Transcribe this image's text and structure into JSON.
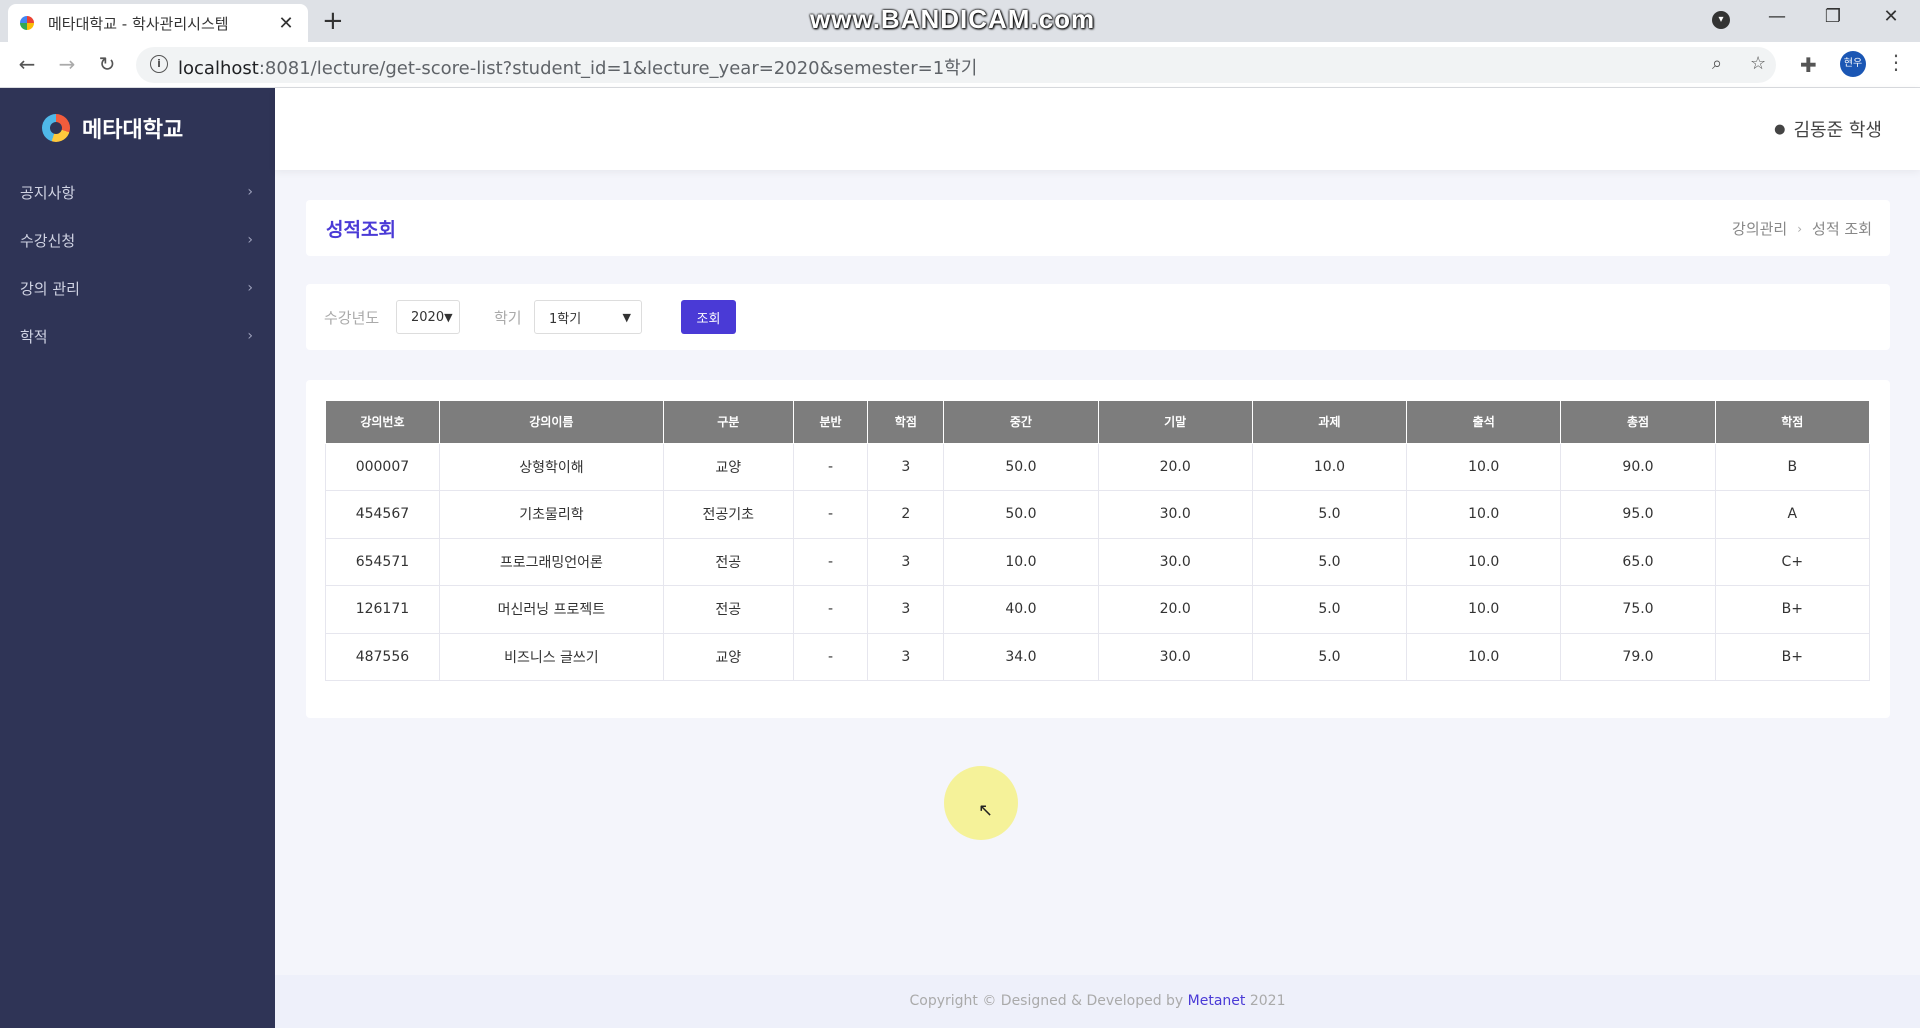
{
  "browser": {
    "tab_title": "메타대학교 - 학사관리시스템",
    "tab_close": "✕",
    "new_tab": "+",
    "watermark": "www.BANDICAM.com",
    "url_host": "localhost",
    "url_rest": ":8081/lecture/get-score-list?student_id=1&lecture_year=2020&semester=1학기",
    "profile_label": "현우"
  },
  "brand": {
    "name": "메타대학교"
  },
  "sidebar": {
    "items": [
      {
        "label": "공지사항"
      },
      {
        "label": "수강신청"
      },
      {
        "label": "강의 관리"
      },
      {
        "label": "학적"
      }
    ]
  },
  "header": {
    "user": "김동준 학생"
  },
  "page": {
    "title": "성적조회",
    "breadcrumb": [
      "강의관리",
      "성적 조회"
    ]
  },
  "filter": {
    "year_label": "수강년도",
    "year_value": "2020",
    "semester_label": "학기",
    "semester_value": "1학기",
    "search_label": "조회"
  },
  "table": {
    "headers": [
      "강의번호",
      "강의이름",
      "구분",
      "분반",
      "학점",
      "중간",
      "기말",
      "과제",
      "출석",
      "총점",
      "학점"
    ],
    "rows": [
      [
        "000007",
        "상형학이해",
        "교양",
        "-",
        "3",
        "50.0",
        "20.0",
        "10.0",
        "10.0",
        "90.0",
        "B"
      ],
      [
        "454567",
        "기초물리학",
        "전공기초",
        "-",
        "2",
        "50.0",
        "30.0",
        "5.0",
        "10.0",
        "95.0",
        "A"
      ],
      [
        "654571",
        "프로그래밍언어론",
        "전공",
        "-",
        "3",
        "10.0",
        "30.0",
        "5.0",
        "10.0",
        "65.0",
        "C+"
      ],
      [
        "126171",
        "머신러닝 프로젝트",
        "전공",
        "-",
        "3",
        "40.0",
        "20.0",
        "5.0",
        "10.0",
        "75.0",
        "B+"
      ],
      [
        "487556",
        "비즈니스 글쓰기",
        "교양",
        "-",
        "3",
        "34.0",
        "30.0",
        "5.0",
        "10.0",
        "79.0",
        "B+"
      ]
    ]
  },
  "footer": {
    "prefix": "Copyright © Designed & Developed by ",
    "brand": "Metanet",
    "year": " 2021"
  },
  "colors": {
    "accent": "#4a3ad6",
    "sidebar_bg": "#2f3456",
    "table_header": "#7d7d7d"
  }
}
